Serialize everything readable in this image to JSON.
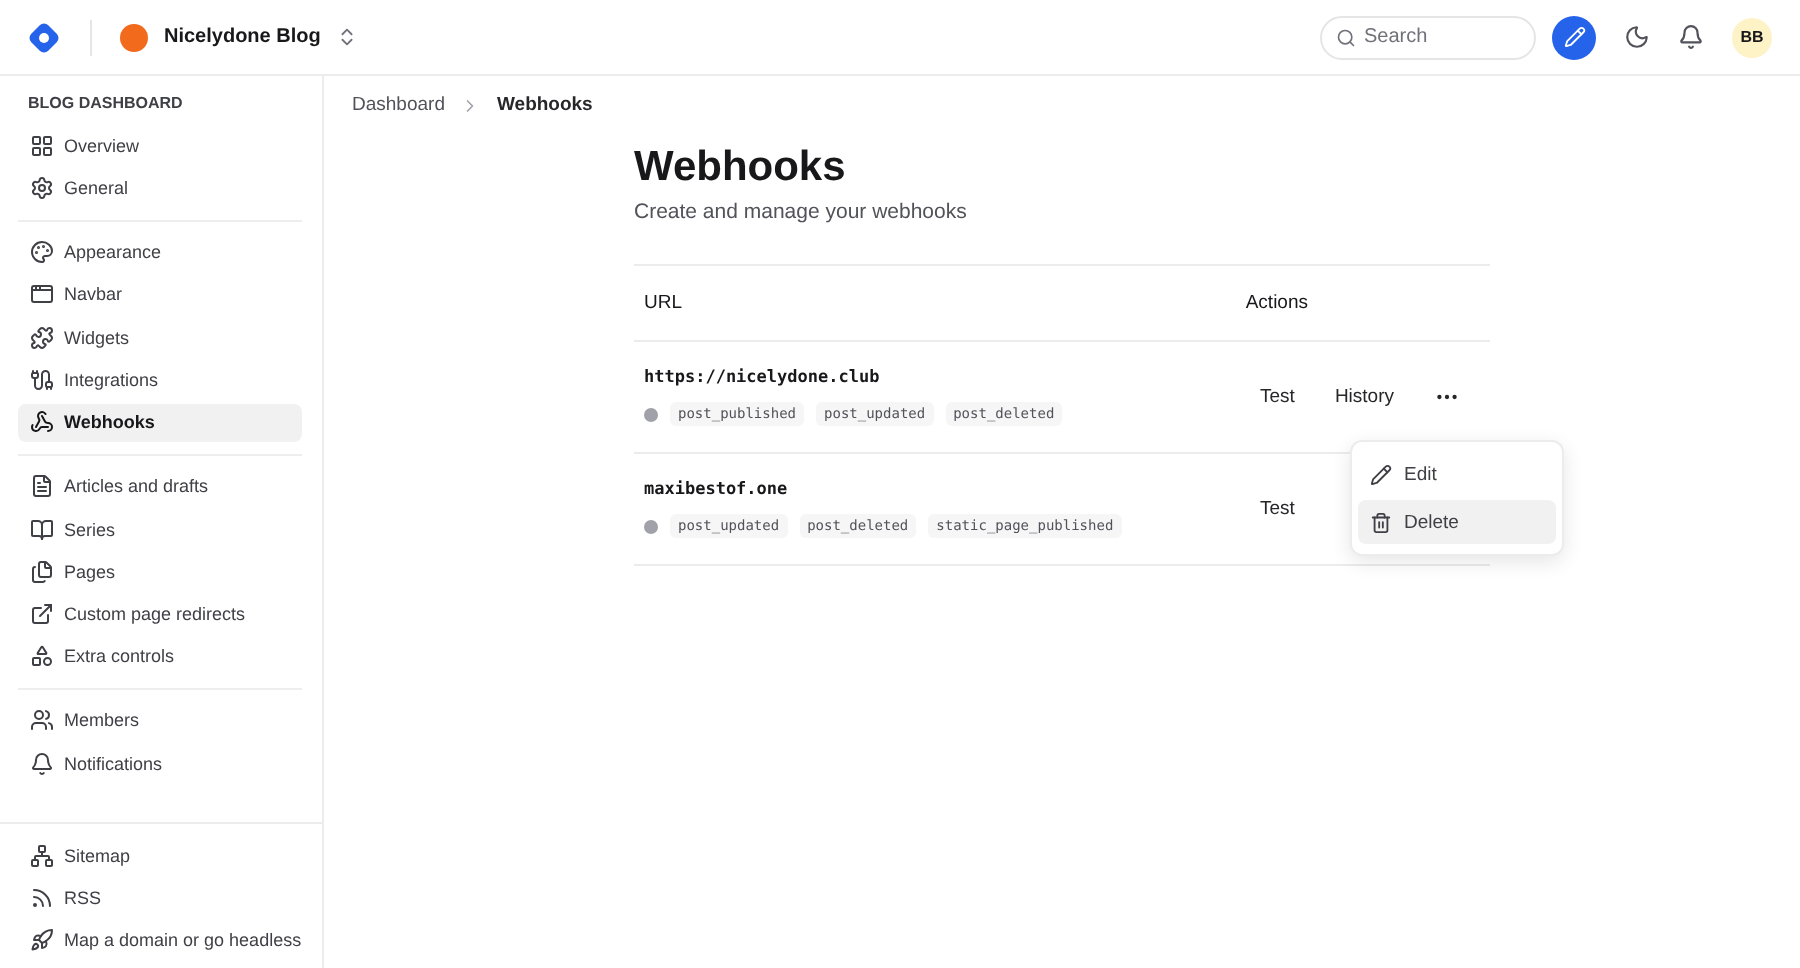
{
  "header": {
    "blog_name": "Nicelydone Blog",
    "search": {
      "placeholder": "Search"
    },
    "avatar": "BB"
  },
  "sidebar": {
    "heading": "BLOG DASHBOARD",
    "sections": [
      [
        {
          "label": "Overview",
          "selected": false
        },
        {
          "label": "General",
          "selected": false
        }
      ],
      [
        {
          "label": "Appearance",
          "selected": false
        },
        {
          "label": "Navbar",
          "selected": false
        },
        {
          "label": "Widgets",
          "selected": false
        },
        {
          "label": "Integrations",
          "selected": false
        },
        {
          "label": "Webhooks",
          "selected": true
        }
      ],
      [
        {
          "label": "Articles and drafts",
          "selected": false
        },
        {
          "label": "Series",
          "selected": false
        },
        {
          "label": "Pages",
          "selected": false
        },
        {
          "label": "Custom page redirects",
          "selected": false
        },
        {
          "label": "Extra controls",
          "selected": false
        }
      ],
      [
        {
          "label": "Members",
          "selected": false
        },
        {
          "label": "Notifications",
          "selected": false
        }
      ]
    ],
    "footer": [
      {
        "label": "Sitemap",
        "selected": false
      },
      {
        "label": "RSS",
        "selected": false
      },
      {
        "label": "Map a domain or go headless",
        "selected": false
      }
    ]
  },
  "breadcrumb": [
    "Dashboard",
    "Webhooks"
  ],
  "page": {
    "title": "Webhooks",
    "subtitle": "Create and manage your webhooks"
  },
  "table": {
    "columns": [
      "URL",
      "Actions"
    ],
    "rows": [
      {
        "url": "https://nicelydone.club",
        "events": [
          "post_published",
          "post_updated",
          "post_deleted"
        ],
        "actions": [
          "Test",
          "History"
        ]
      },
      {
        "url": "maxibestof.one",
        "events": [
          "post_updated",
          "post_deleted",
          "static_page_published"
        ],
        "actions": [
          "Test"
        ]
      }
    ]
  },
  "menu": [
    {
      "label": "Edit",
      "selected": false
    },
    {
      "label": "Delete",
      "selected": true
    }
  ]
}
